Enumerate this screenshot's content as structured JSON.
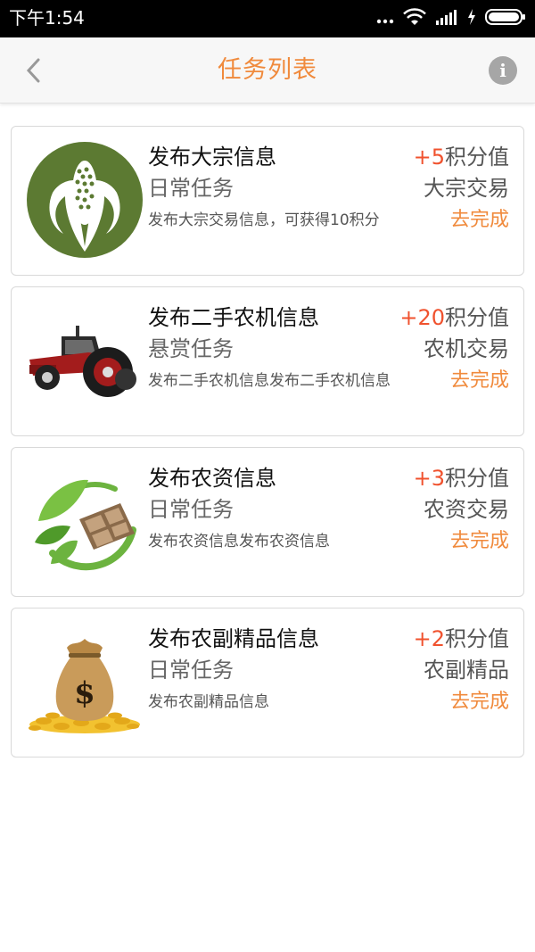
{
  "status_bar": {
    "time": "下午1:54",
    "icons": [
      "more-dots-icon",
      "wifi-icon",
      "signal-icon",
      "charging-icon",
      "battery-icon"
    ]
  },
  "header": {
    "title": "任务列表",
    "back_icon": "chevron-left-icon",
    "info_label": "i"
  },
  "colors": {
    "accent": "#f08a3c",
    "points": "#f0522e"
  },
  "tasks": [
    {
      "name": "发布大宗信息",
      "type": "日常任务",
      "description": "发布大宗交易信息，可获得10积分",
      "points_prefix": "+5",
      "points_suffix": "积分值",
      "category": "大宗交易",
      "action": "去完成",
      "icon": "corn-icon"
    },
    {
      "name": "发布二手农机信息",
      "type": "悬赏任务",
      "description": "发布二手农机信息发布二手农机信息",
      "points_prefix": "+20",
      "points_suffix": "积分值",
      "category": "农机交易",
      "action": "去完成",
      "icon": "tractor-icon"
    },
    {
      "name": "发布农资信息",
      "type": "日常任务",
      "description": "发布农资信息发布农资信息",
      "points_prefix": "+3",
      "points_suffix": "积分值",
      "category": "农资交易",
      "action": "去完成",
      "icon": "leaf-seed-icon"
    },
    {
      "name": "发布农副精品信息",
      "type": "日常任务",
      "description": "发布农副精品信息",
      "points_prefix": "+2",
      "points_suffix": "积分值",
      "category": "农副精品",
      "action": "去完成",
      "icon": "money-bag-icon"
    }
  ]
}
